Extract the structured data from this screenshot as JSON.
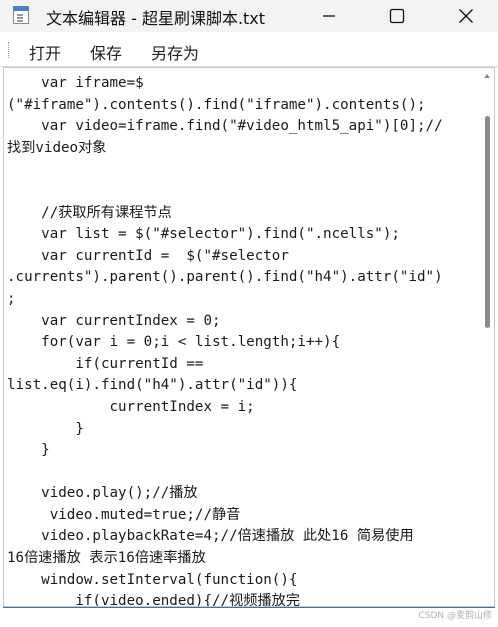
{
  "window": {
    "title": "文本编辑器 - 超星刷课脚本.txt",
    "icon": "notepad-icon",
    "controls": [
      "minimize-icon",
      "maximize-icon",
      "close-icon"
    ]
  },
  "menu": {
    "open": "打开",
    "save": "保存",
    "save_as": "另存为"
  },
  "editor": {
    "lines": [
      "    var iframe=$",
      "(\"#iframe\").contents().find(\"iframe\").contents();",
      "    var video=iframe.find(\"#video_html5_api\")[0];//",
      "找到video对象",
      "",
      "",
      "    //获取所有课程节点",
      "    var list = $(\"#selector\").find(\".ncells\");",
      "    var currentId =  $(\"#selector",
      ".currents\").parent().parent().find(\"h4\").attr(\"id\")",
      ";",
      "    var currentIndex = 0;",
      "    for(var i = 0;i < list.length;i++){",
      "        if(currentId ==",
      "list.eq(i).find(\"h4\").attr(\"id\")){",
      "            currentIndex = i;",
      "        }",
      "    }",
      "",
      "    video.play();//播放",
      "     video.muted=true;//静音",
      "    video.playbackRate=4;//倍速播放 此处16 简易使用",
      "16倍速播放 表示16倍速率播放",
      "    window.setInterval(function(){",
      "        if(video.ended){//视频播放完"
    ]
  },
  "watermark": "CSDN @麦韵山修"
}
